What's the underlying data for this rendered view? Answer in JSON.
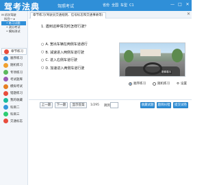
{
  "app": {
    "brand": "驾考法典",
    "subtitle": "驾照考试",
    "user_label": "省份",
    "province": "全国",
    "car_label": "车型",
    "car_type": "C1"
  },
  "window_buttons": [
    "—",
    "□",
    "✕"
  ],
  "sidebar": {
    "tree": [
      {
        "label": "⊟ 初次驾驶",
        "level": 0,
        "active": false
      },
      {
        "label": "科目一 ▸",
        "level": 1,
        "active": false
      },
      {
        "label": "• 练习试题",
        "level": 2,
        "active": true
      },
      {
        "label": "• 测分考试",
        "level": 2,
        "active": false
      },
      {
        "label": "• 模拟测试",
        "level": 2,
        "active": false
      }
    ],
    "nav": [
      {
        "label": "章节练习",
        "color": "#e84c3d",
        "active": true
      },
      {
        "label": "顺序练习",
        "color": "#3b8fd8",
        "active": false
      },
      {
        "label": "随机练习",
        "color": "#f0a030",
        "active": false
      },
      {
        "label": "专项练习",
        "color": "#5bb85d",
        "active": false
      },
      {
        "label": "考试题库",
        "color": "#9b59b6",
        "active": false
      },
      {
        "label": "模拟考试",
        "color": "#e67e22",
        "active": false
      },
      {
        "label": "错题练习",
        "color": "#e74c3c",
        "active": false
      },
      {
        "label": "我的收藏",
        "color": "#1abc9c",
        "active": false
      },
      {
        "label": "科目二",
        "color": "#3498db",
        "active": false
      },
      {
        "label": "科目三",
        "color": "#2ecc71",
        "active": false
      },
      {
        "label": "交通标志",
        "color": "#e84c3d",
        "active": false
      }
    ]
  },
  "tab": {
    "label": "章节练习(驾驶员交通规则、信号标志和交通事故等)"
  },
  "question": {
    "text": "1. 遇到这种情况时怎样行驶？",
    "options": [
      "A. 宽出车辆在两侧车道通行",
      "B. 减速进入两侧车道行驶",
      "C. 进入右侧车道行驶",
      "D. 加速进入两侧车道行驶"
    ],
    "image_caption": "图像展示"
  },
  "modes": {
    "sequence": "顺序练习",
    "random": "随机练习",
    "settings": "设置"
  },
  "bottom": {
    "prev": "上一题",
    "next": "下一题",
    "show_answer": "显示答案",
    "page": "1/295",
    "jump_label": "跳到",
    "collect": "收藏试题",
    "error_report": "题目纠错",
    "submit": "提交试卷"
  }
}
